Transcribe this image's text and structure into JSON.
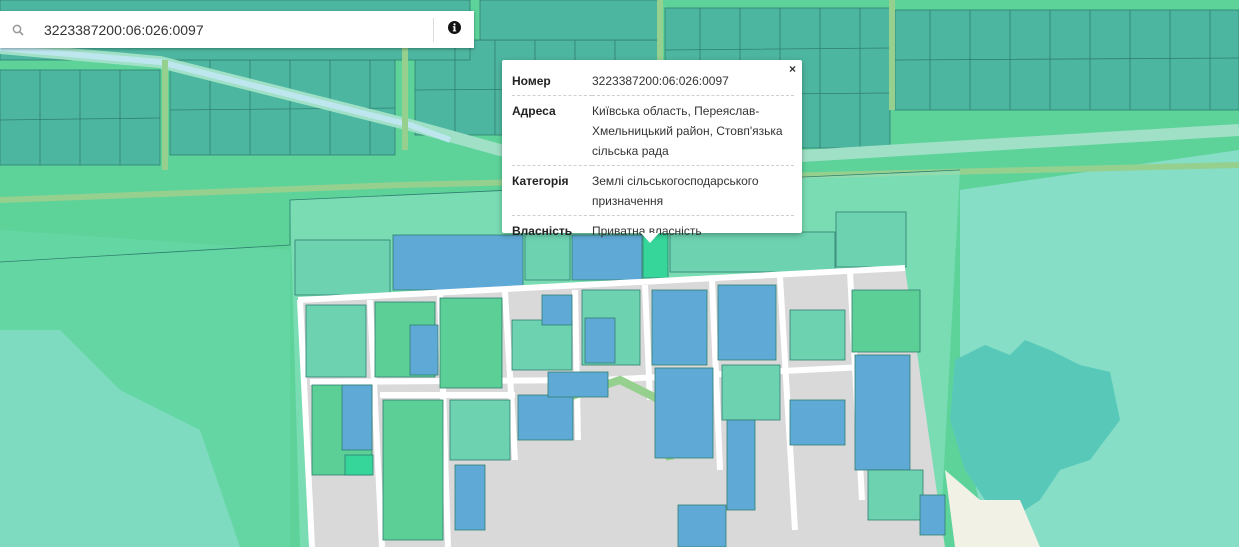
{
  "search": {
    "value": "3223387200:06:026:0097",
    "placeholder": ""
  },
  "icons": {
    "search": "search-icon",
    "info": "info-icon",
    "close": "close-icon"
  },
  "popup": {
    "close_label": "×",
    "rows": [
      {
        "key": "Номер",
        "value": "3223387200:06:026:0097"
      },
      {
        "key": "Адреса",
        "value": "Київська область, Переяслав-Хмельницький район, Стовп'язька сільська рада"
      },
      {
        "key": "Категорія",
        "value": "Землі сільськогосподарського призначення"
      },
      {
        "key": "Власність",
        "value": "Приватна власність"
      }
    ]
  },
  "colors": {
    "forest": "#5dd39a",
    "meadow": "#7fdcc0",
    "water": "#58c9b9",
    "parcel_teal": "#4db6a0",
    "parcel_green": "#5bcf96",
    "parcel_blue": "#5fa9d6",
    "road": "#ffffff",
    "road_green": "#95d08f",
    "settlement": "#d9d9d9",
    "selected": "#36d69a",
    "sand": "#f2f1e6"
  }
}
